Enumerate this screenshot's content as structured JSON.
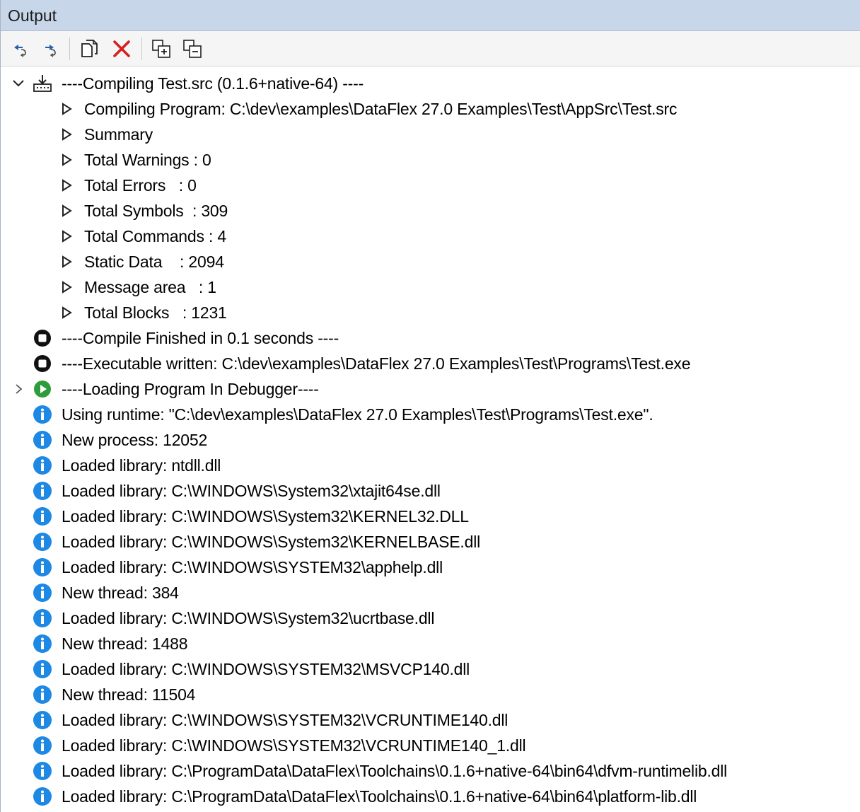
{
  "panel": {
    "title": "Output"
  },
  "toolbar": {
    "buttons": [
      {
        "icon": "previous-message-icon"
      },
      {
        "icon": "next-message-icon"
      },
      {
        "icon": "copy-icon"
      },
      {
        "icon": "clear-icon"
      },
      {
        "icon": "expand-all-icon"
      },
      {
        "icon": "collapse-all-icon"
      }
    ]
  },
  "tree": {
    "root": {
      "text": "----Compiling Test.src (0.1.6+native-64) ----"
    },
    "children": [
      {
        "text": "Compiling Program: C:\\dev\\examples\\DataFlex 27.0 Examples\\Test\\AppSrc\\Test.src"
      },
      {
        "text": "Summary"
      },
      {
        "text": "Total Warnings : 0"
      },
      {
        "text": "Total Errors   : 0"
      },
      {
        "text": "Total Symbols  : 309"
      },
      {
        "text": "Total Commands : 4"
      },
      {
        "text": "Static Data    : 2094"
      },
      {
        "text": "Message area   : 1"
      },
      {
        "text": "Total Blocks   : 1231"
      }
    ],
    "status": [
      {
        "text": "----Compile Finished in 0.1 seconds ----"
      },
      {
        "text": "----Executable written: C:\\dev\\examples\\DataFlex 27.0 Examples\\Test\\Programs\\Test.exe"
      }
    ],
    "debugger": {
      "text": "----Loading Program In Debugger----"
    },
    "messages": [
      "Using runtime: \"C:\\dev\\examples\\DataFlex 27.0 Examples\\Test\\Programs\\Test.exe\".",
      "New process: 12052",
      "Loaded library: ntdll.dll",
      "Loaded library: C:\\WINDOWS\\System32\\xtajit64se.dll",
      "Loaded library: C:\\WINDOWS\\System32\\KERNEL32.DLL",
      "Loaded library: C:\\WINDOWS\\System32\\KERNELBASE.dll",
      "Loaded library: C:\\WINDOWS\\SYSTEM32\\apphelp.dll",
      "New thread: 384",
      "Loaded library: C:\\WINDOWS\\System32\\ucrtbase.dll",
      "New thread: 1488",
      "Loaded library: C:\\WINDOWS\\SYSTEM32\\MSVCP140.dll",
      "New thread: 11504",
      "Loaded library: C:\\WINDOWS\\SYSTEM32\\VCRUNTIME140.dll",
      "Loaded library: C:\\WINDOWS\\SYSTEM32\\VCRUNTIME140_1.dll",
      "Loaded library: C:\\ProgramData\\DataFlex\\Toolchains\\0.1.6+native-64\\bin64\\dfvm-runtimelib.dll",
      "Loaded library: C:\\ProgramData\\DataFlex\\Toolchains\\0.1.6+native-64\\bin64\\platform-lib.dll"
    ]
  },
  "colors": {
    "title_bg": "#c8d6e9",
    "info_icon": "#1e88e5",
    "run_icon": "#2e9c3a",
    "delete_icon": "#d32020"
  }
}
